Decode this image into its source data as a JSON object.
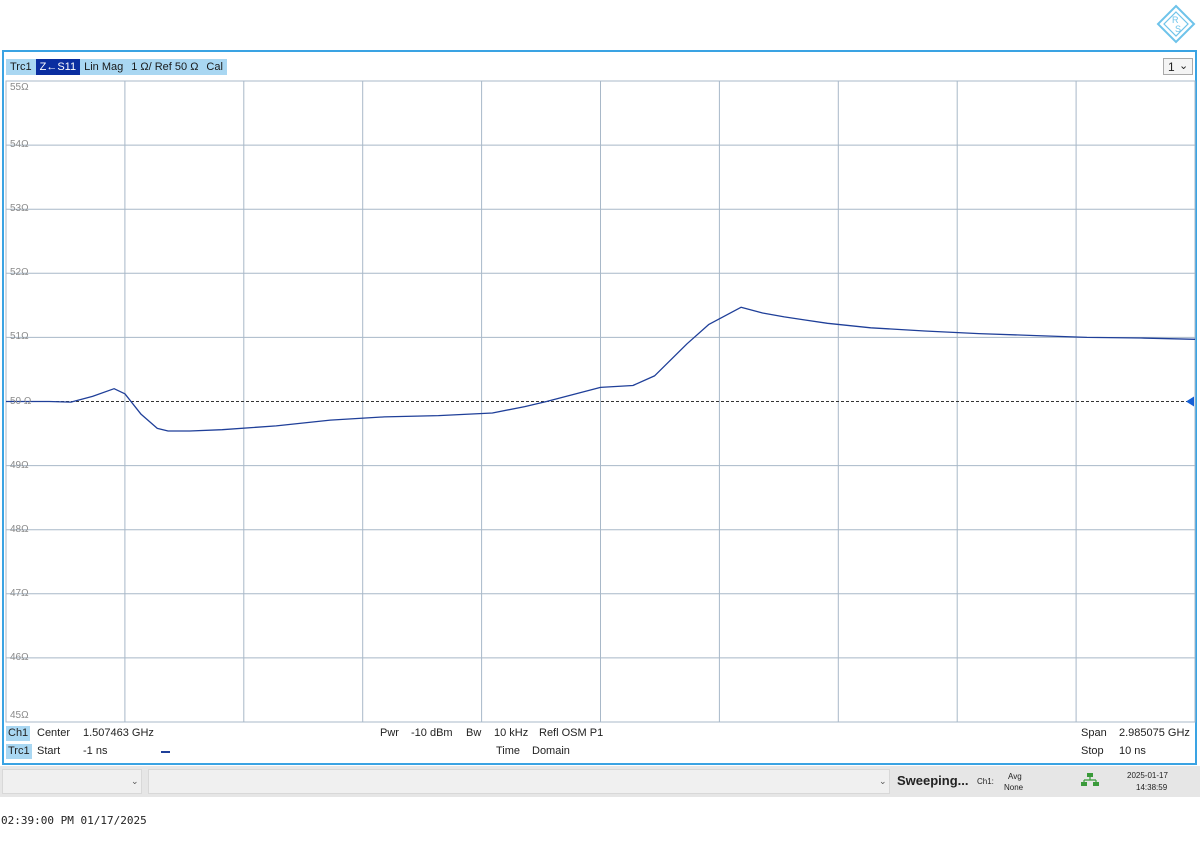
{
  "trace_bar": {
    "trace": "Trc1",
    "param": "Z←S11",
    "format": "Lin Mag",
    "scale": "1 Ω/ Ref 50 Ω",
    "cal": "Cal"
  },
  "diagram_select": "1",
  "channel_info": {
    "ch_tag": "Ch1",
    "trc_tag": "Trc1",
    "center_label": "Center",
    "center_value": "1.507463 GHz",
    "start_label": "Start",
    "start_value": "-1 ns",
    "pwr_label": "Pwr",
    "pwr_value": "-10 dBm",
    "bw_label": "Bw",
    "bw_value": "10 kHz",
    "refl": "Refl OSM P1",
    "time_label": "Time",
    "domain_label": "Domain",
    "span_label": "Span",
    "span_value": "2.985075 GHz",
    "stop_label": "Stop",
    "stop_value": "10 ns"
  },
  "status": {
    "sweeping": "Sweeping...",
    "ch": "Ch1:",
    "avg": "Avg",
    "avg_value": "None",
    "date": "2025-01-17",
    "time": "14:38:59"
  },
  "timestamp": "02:39:00 PM 01/17/2025",
  "colors": {
    "trace": "#1f3f99",
    "grid": "#a8b8c8",
    "frame": "#3aa3e3",
    "tag": "#a9d7f2",
    "tag_selected": "#0a2ea0"
  },
  "chart_data": {
    "type": "line",
    "xlim": [
      -1,
      10
    ],
    "ylim": [
      45,
      55
    ],
    "unit": "Ω",
    "y_ticks": [
      "55Ω",
      "54Ω",
      "53Ω",
      "52Ω",
      "51Ω",
      "50 Ω",
      "49Ω",
      "48Ω",
      "47Ω",
      "46Ω",
      "45Ω"
    ],
    "reference": 50,
    "grid": true,
    "series": [
      {
        "x": [
          -1,
          -0.6,
          -0.4,
          -0.2,
          0.0,
          0.1,
          0.25,
          0.4,
          0.5,
          0.7,
          1.0,
          1.5,
          2.0,
          2.5,
          3.0,
          3.5,
          3.8,
          4.0,
          4.5,
          4.8,
          5.0,
          5.3,
          5.5,
          5.8,
          6.0,
          6.2,
          6.4,
          6.6,
          7.0,
          7.5,
          8.0,
          8.5,
          9.0,
          9.5,
          10.0
        ],
        "y": [
          50.0,
          50.0,
          49.99,
          50.08,
          50.2,
          50.12,
          49.8,
          49.58,
          49.54,
          49.54,
          49.56,
          49.62,
          49.71,
          49.76,
          49.78,
          49.82,
          49.92,
          50.0,
          50.22,
          50.25,
          50.4,
          50.9,
          51.2,
          51.47,
          51.38,
          51.32,
          51.27,
          51.22,
          51.15,
          51.1,
          51.06,
          51.03,
          51.0,
          50.99,
          50.97
        ]
      }
    ]
  }
}
